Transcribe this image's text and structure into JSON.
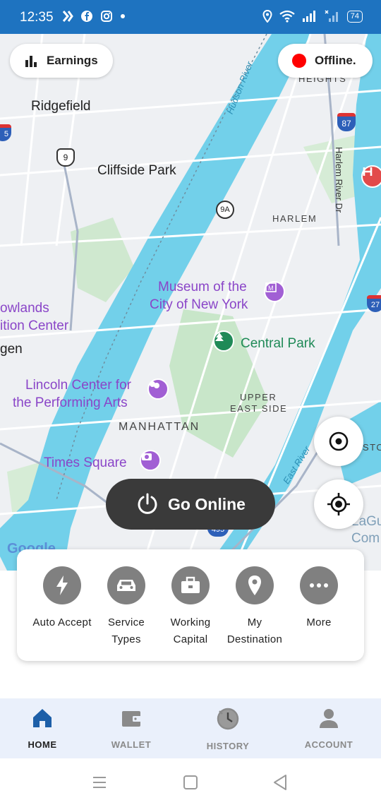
{
  "status_bar": {
    "time": "12:35",
    "battery": "74"
  },
  "top_bar": {
    "earnings_label": "Earnings",
    "status_label": "Offline."
  },
  "map": {
    "places": {
      "ridgefield": "Ridgefield",
      "cliffside_park": "Cliffside Park",
      "harlem": "HARLEM",
      "heights": "HEIGHTS",
      "museum_line1": "Museum of the",
      "museum_line2": "City of New York",
      "central_park": "Central Park",
      "meadowlands_line1": "owlands",
      "meadowlands_line2": "ition Center",
      "gen": "gen",
      "lincoln_line1": "Lincoln Center for",
      "lincoln_line2": "the Performing Arts",
      "upper_east_line1": "UPPER",
      "upper_east_line2": "EAST SIDE",
      "manhattan": "MANHATTAN",
      "times_square": "Times Square",
      "hudson_river": "Hudson River",
      "harlem_river_dr": "Harlem River Dr",
      "east_river": "East River",
      "sto": "STO",
      "lagu_line1": "LaGu",
      "lagu_line2": "Com",
      "google": "Google"
    },
    "route_shields": {
      "r9": "9",
      "r9a": "9A",
      "r87": "87",
      "r495": "495",
      "r27": "27",
      "r5": "5"
    }
  },
  "go_online_label": "Go Online",
  "quick_actions": [
    {
      "icon": "lightning-icon",
      "label": "Auto Accept"
    },
    {
      "icon": "car-icon",
      "label": "Service Types"
    },
    {
      "icon": "briefcase-icon",
      "label": "Working Capital"
    },
    {
      "icon": "location-pin-icon",
      "label": "My Destination"
    },
    {
      "icon": "more-dots-icon",
      "label": "More"
    }
  ],
  "bottom_nav": [
    {
      "icon": "home-icon",
      "label": "HOME",
      "active": true
    },
    {
      "icon": "wallet-icon",
      "label": "WALLET",
      "active": false
    },
    {
      "icon": "history-icon",
      "label": "HISTORY",
      "active": false
    },
    {
      "icon": "account-icon",
      "label": "ACCOUNT",
      "active": false
    }
  ],
  "colors": {
    "status_bar": "#1e73c0",
    "active_nav": "#1d5fa8",
    "inactive_nav": "#8a8a8a",
    "offline_dot": "#ff0000",
    "go_online_bg": "#3a3a3a",
    "water": "#72d0ea",
    "park": "#c8e6c9"
  }
}
